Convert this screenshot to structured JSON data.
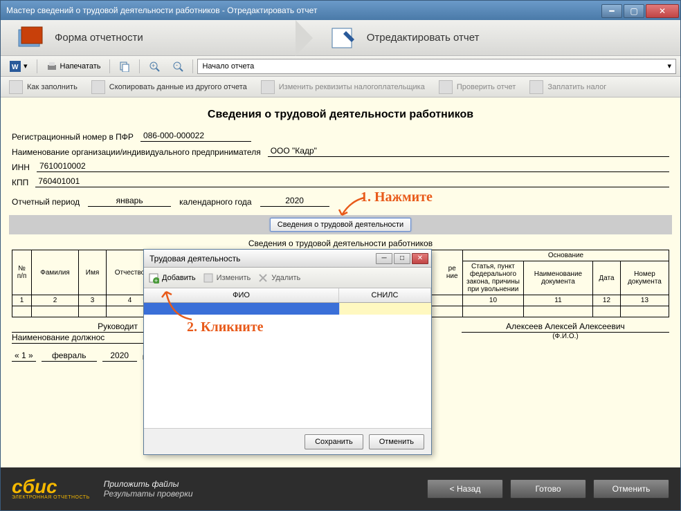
{
  "window_title": "Мастер сведений о трудовой деятельности работников - Отредактировать отчет",
  "wizard": {
    "step1": "Форма отчетности",
    "step2": "Отредактировать отчет"
  },
  "toolbar1": {
    "print": "Напечатать",
    "combo": "Начало отчета"
  },
  "toolbar2": {
    "howto": "Как заполнить",
    "copy": "Скопировать данные из другого отчета",
    "edit_req": "Изменить реквизиты налогоплательщика",
    "check": "Проверить отчет",
    "pay": "Заплатить налог"
  },
  "doc": {
    "title": "Сведения о трудовой деятельности работников",
    "reg_label": "Регистрационный номер в ПФР",
    "reg_value": "086-000-000022",
    "org_label": "Наименование организации/индивидуального предпринимателя",
    "org_value": "ООО \"Кадр\"",
    "inn_label": "ИНН",
    "inn_value": "7610010002",
    "kpp_label": "КПП",
    "kpp_value": "760401001",
    "period_label": "Отчетный период",
    "period_month": "январь",
    "period_year_label": "календарного года",
    "period_year": "2020",
    "grey_button": "Сведения о трудовой деятельности",
    "table_title": "Сведения о трудовой деятельности работников"
  },
  "table": {
    "h_num": "№ п/п",
    "h_fam": "Фамилия",
    "h_name": "Имя",
    "h_otch": "Отчество",
    "h_osnovanie": "Основание",
    "h_statya": "Статья, пункт федерального закона, причины при увольнении",
    "h_naim": "Наименование документа",
    "h_data": "Дата",
    "h_nomer": "Номер документа",
    "c1": "1",
    "c2": "2",
    "c3": "3",
    "c4": "4",
    "c10": "10",
    "c11": "11",
    "c12": "12",
    "c13": "13"
  },
  "sig": {
    "leader_label": "Руководит",
    "leader_name": "Алексеев Алексей Алексеевич",
    "fio": "(Ф.И.О.)",
    "pos_label": "Наименование должнос"
  },
  "correction": {
    "num": "« 1 »",
    "month": "февраль",
    "year": "2020",
    "g": "г."
  },
  "annotations": {
    "a1": "1. Нажмите",
    "a2": "2. Кликните"
  },
  "modal": {
    "title": "Трудовая деятельность",
    "add": "Добавить",
    "edit": "Изменить",
    "delete": "Удалить",
    "col_fio": "ФИО",
    "col_snils": "СНИЛС",
    "save": "Сохранить",
    "cancel": "Отменить"
  },
  "bottom": {
    "logo": "сбис",
    "logo_sub": "ЭЛЕКТРОННАЯ ОТЧЕТНОСТЬ",
    "attach": "Приложить файлы",
    "results": "Результаты проверки",
    "back": "< Назад",
    "ready": "Готово",
    "cancel": "Отменить"
  }
}
